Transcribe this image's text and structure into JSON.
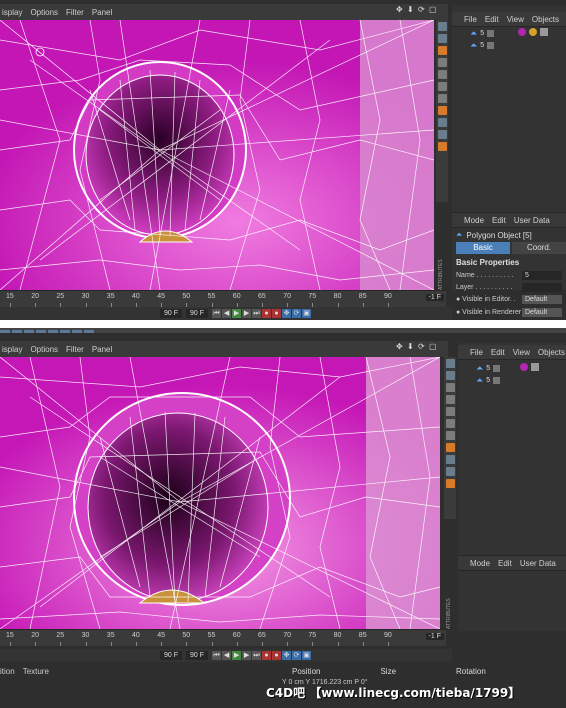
{
  "viewport_menu": [
    "isplay",
    "Options",
    "Filter",
    "Panel"
  ],
  "object_manager": {
    "menu_top": [
      "File",
      "Edit",
      "View",
      "Objects",
      "Ta"
    ],
    "menu_bottom": [
      "File",
      "Edit",
      "View",
      "Objects",
      "Ta"
    ],
    "objects_top": [
      {
        "name": "5"
      },
      {
        "name": "5"
      }
    ],
    "objects_bottom": [
      {
        "name": "5"
      },
      {
        "name": "5"
      }
    ]
  },
  "attributes": {
    "menu": [
      "Mode",
      "Edit",
      "User Data"
    ],
    "object_title": "Polygon Object [5]",
    "tabs": [
      {
        "label": "Basic"
      },
      {
        "label": "Coord."
      }
    ],
    "section": "Basic Properties",
    "rows": [
      {
        "label": "Name . . . . . . . . . .",
        "value": "5"
      },
      {
        "label": "Layer . . . . . . . . . .",
        "value": ""
      },
      {
        "label": "● Visible in Editor. .",
        "value": "Default"
      },
      {
        "label": "● Visible in Renderer",
        "value": "Default"
      }
    ],
    "side_label_top": "ATTRIBUTES",
    "side_label_bottom": "ATTRIBUTES"
  },
  "timeline_top": {
    "ticks": [
      "15",
      "20",
      "25",
      "30",
      "35",
      "40",
      "45",
      "50",
      "55",
      "60",
      "65",
      "70",
      "75",
      "80",
      "85",
      "90"
    ],
    "frame": "-1 F"
  },
  "timeline_bottom": {
    "ticks": [
      "15",
      "20",
      "25",
      "30",
      "35",
      "40",
      "45",
      "50",
      "55",
      "60",
      "65",
      "70",
      "75",
      "80",
      "85",
      "90"
    ],
    "frame": "-1 F"
  },
  "playbar_top": {
    "field_a": "90 F",
    "field_b": "90 F"
  },
  "playbar_bottom": {
    "field_a": "90 F",
    "field_b": "90 F"
  },
  "material_bar": [
    "ition",
    "Texture"
  ],
  "coordinates": {
    "headers": [
      "Position",
      "Size",
      "Rotation"
    ],
    "row": "Y  0 cm        Y  1716.223 cm   P  0°"
  },
  "watermark": "C4D吧 【www.linecg.com/tieba/1799】",
  "colors": {
    "viewport": "#c716b8",
    "accent": "#d08a2a",
    "tab_active": "#4a7fb8"
  }
}
